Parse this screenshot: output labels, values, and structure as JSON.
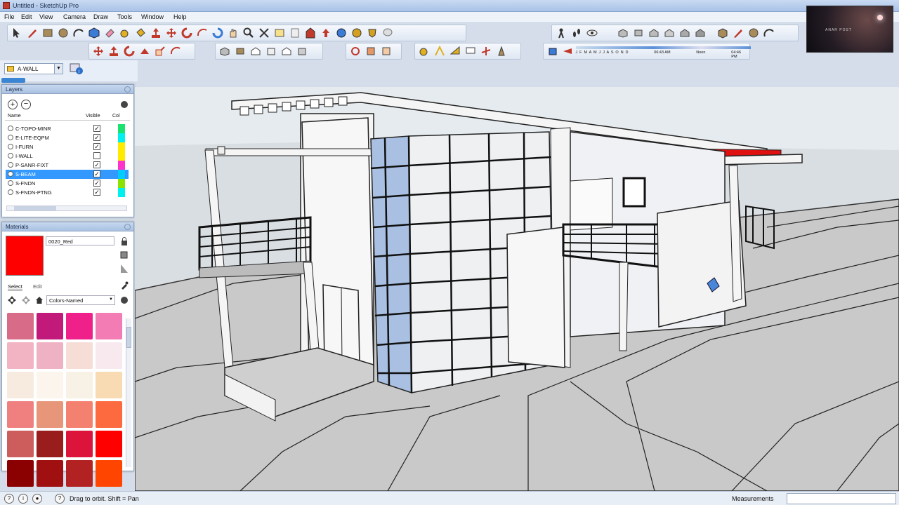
{
  "window": {
    "title": "Untitled - SketchUp Pro"
  },
  "menu": {
    "items": [
      "File",
      "Edit",
      "View",
      "Camera",
      "Draw",
      "Tools",
      "Window",
      "Help"
    ]
  },
  "layer_toolbar": {
    "current_layer": "A-WALL"
  },
  "shadow_toolbar": {
    "months": "J F M A M J J A S O N D",
    "time_start": "06:43 AM",
    "time_mid": "Noon",
    "time_end": "04:46 PM"
  },
  "layers_panel": {
    "title": "Layers",
    "col_name": "Name",
    "col_visible": "Visible",
    "col_color": "Col",
    "rows": [
      {
        "name": "C-TOPO-MINR",
        "visible": true,
        "color": "#19e36e"
      },
      {
        "name": "E-LITE-EQPM",
        "visible": true,
        "color": "#00f0f0"
      },
      {
        "name": "I-FURN",
        "visible": true,
        "color": "#ffeb00"
      },
      {
        "name": "I-WALL",
        "visible": false,
        "color": "#ffeb00"
      },
      {
        "name": "P-SANR-FIXT",
        "visible": true,
        "color": "#ff33cc"
      },
      {
        "name": "S-BEAM",
        "visible": true,
        "color": "#00ccff",
        "selected": true
      },
      {
        "name": "S-FNDN",
        "visible": true,
        "color": "#8de300"
      },
      {
        "name": "S-FNDN-PTNG",
        "visible": true,
        "color": "#00f0f0"
      }
    ]
  },
  "materials_panel": {
    "title": "Materials",
    "current_material": "0020_Red",
    "current_color": "#ff0000",
    "tab_select": "Select",
    "tab_edit": "Edit",
    "collection": "Colors-Named",
    "swatches": [
      "#d86b87",
      "#c21a7a",
      "#f0208a",
      "#f47cb4",
      "#f2b3c2",
      "#efb1c4",
      "#f6ddd6",
      "#f7e9ee",
      "#f7ebe0",
      "#fbf5ee",
      "#f8f1e6",
      "#f9dbb3",
      "#f08080",
      "#e8967a",
      "#f48070",
      "#fe6a40",
      "#cd5c5c",
      "#9a1d1d",
      "#dc143c",
      "#ff0000",
      "#8b0000",
      "#a01010",
      "#b22222",
      "#ff4500"
    ]
  },
  "status": {
    "text": "Drag to orbit.  Shift = Pan",
    "measurements_label": "Measurements",
    "measurements_value": ""
  },
  "video_overlay": {
    "text": "ANAR POST"
  }
}
